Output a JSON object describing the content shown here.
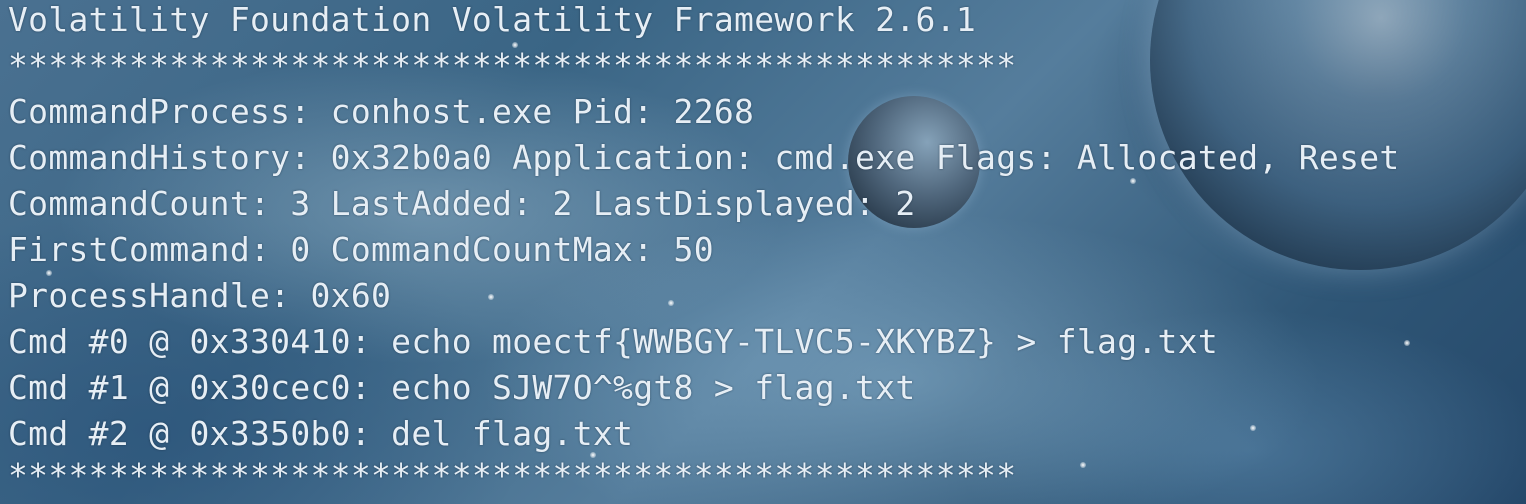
{
  "terminal": {
    "lines": [
      "Volatility Foundation Volatility Framework 2.6.1",
      "**************************************************",
      "CommandProcess: conhost.exe Pid: 2268",
      "CommandHistory: 0x32b0a0 Application: cmd.exe Flags: Allocated, Reset",
      "CommandCount: 3 LastAdded: 2 LastDisplayed: 2",
      "FirstCommand: 0 CommandCountMax: 50",
      "ProcessHandle: 0x60",
      "Cmd #0 @ 0x330410: echo moectf{WWBGY-TLVC5-XKYBZ} > flag.txt",
      "Cmd #1 @ 0x30cec0: echo SJW7O^%gt8 > flag.txt",
      "Cmd #2 @ 0x3350b0: del flag.txt",
      "**************************************************"
    ]
  }
}
